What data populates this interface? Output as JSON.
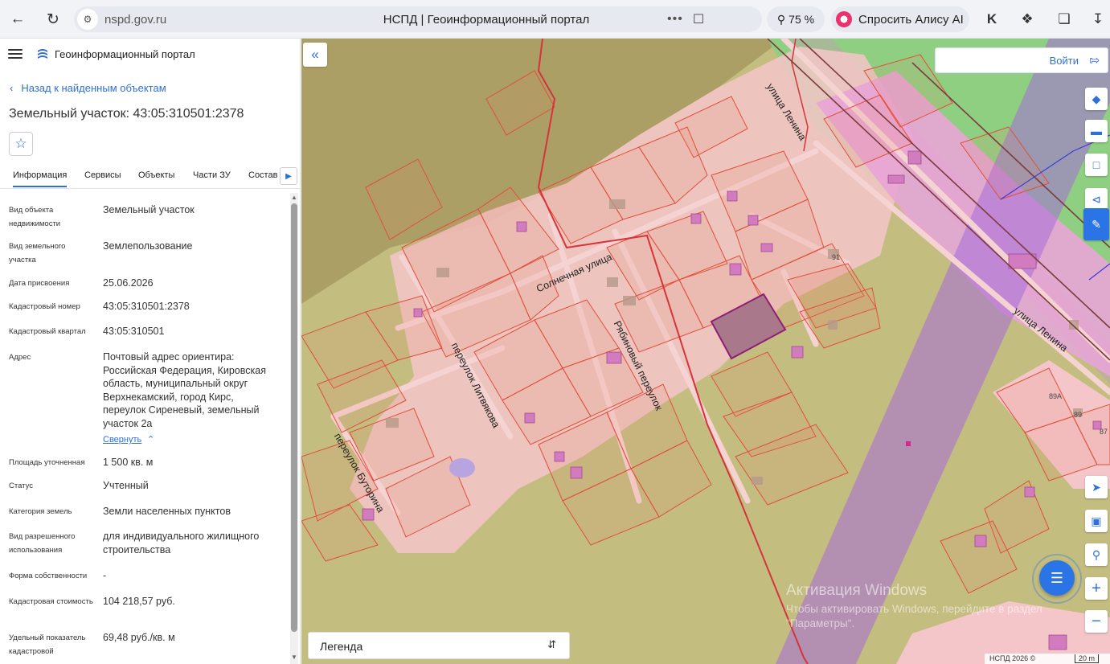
{
  "browser": {
    "url": "nspd.gov.ru",
    "page_title": "НСПД | Геоинформационный портал",
    "zoom": "75 %",
    "assistant_label": "Спросить Алису AI"
  },
  "sidebar": {
    "portal_name": "Геоинформационный портал",
    "back_link": "Назад к найденным объектам",
    "object_title": "Земельный участок: 43:05:310501:2378",
    "tabs": [
      {
        "label": "Информация",
        "active": true
      },
      {
        "label": "Сервисы"
      },
      {
        "label": "Объекты"
      },
      {
        "label": "Части ЗУ"
      },
      {
        "label": "Состав"
      }
    ],
    "properties": [
      {
        "label": "Вид объекта недвижимости",
        "value": "Земельный участок"
      },
      {
        "label": "Вид земельного участка",
        "value": "Землепользование"
      },
      {
        "label": "Дата присвоения",
        "value": "25.06.2026"
      },
      {
        "label": "Кадастровый номер",
        "value": "43:05:310501:2378"
      },
      {
        "label": "Кадастровый квартал",
        "value": "43:05:310501"
      },
      {
        "label": "Адрес",
        "value": "Почтовый адрес ориентира: Российская Федерация, Кировская область, муниципальный округ Верхнекамский, город Кирс, переулок Сиреневый, земельный участок 2а"
      },
      {
        "label": "Площадь уточненная",
        "value": "1 500 кв. м"
      },
      {
        "label": "Статус",
        "value": "Учтенный"
      },
      {
        "label": "Категория земель",
        "value": "Земли населенных пунктов"
      },
      {
        "label": "Вид разрешенного использования",
        "value": "для индивидуального жилищного строительства"
      },
      {
        "label": "Форма собственности",
        "value": "-"
      },
      {
        "label": "Кадастровая стоимость",
        "value": "104 218,57 руб."
      },
      {
        "label": "Удельный показатель кадастровой",
        "value": "69,48 руб./кв. м"
      }
    ],
    "collapse_label": "Свернуть"
  },
  "map": {
    "login_label": "Войти",
    "legend_label": "Легенда",
    "street_labels": [
      "улица Ленина",
      "Солнечная улица",
      "Рябиновый переулок",
      "переулок Литвякова",
      "переулок Буторина",
      "улица Ленина"
    ],
    "parcel_numbers": [
      "91",
      "89А",
      "89",
      "87"
    ],
    "attribution": "НСПД 2026 ©",
    "scale": "20 m",
    "watermark_title": "Активация Windows",
    "watermark_text": "Чтобы активировать Windows, перейдите в раздел \"Параметры\"."
  },
  "colors": {
    "accent": "#2f6fd8",
    "map_base": "#c4bd80",
    "residential_zone": "#f4c6c9",
    "cadastral_border": "#e0503c",
    "selected_parcel": "#8f1f74",
    "protection_zone": "#a66bd8"
  },
  "icons": {
    "map_tools": [
      "layers-icon",
      "ruler-icon",
      "select-area-icon",
      "share-icon",
      "locate-icon",
      "panel-icon",
      "marker-search-icon",
      "zoom-in-icon",
      "zoom-out-icon"
    ]
  }
}
